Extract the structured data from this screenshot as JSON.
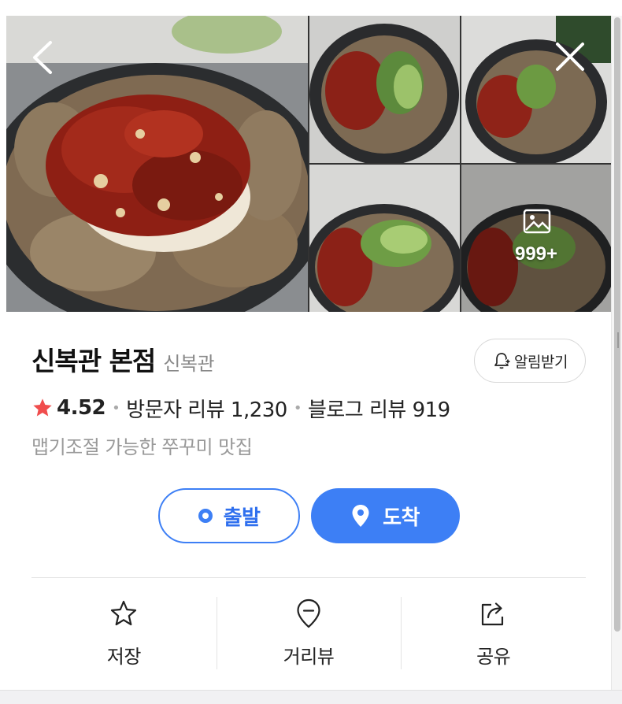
{
  "place": {
    "name": "신복관 본점",
    "category": "신복관",
    "rating": "4.52",
    "visitor_reviews": "방문자 리뷰 1,230",
    "blog_reviews": "블로그 리뷰 919",
    "description": "맵기조절 가능한 쭈꾸미 맛집"
  },
  "gallery": {
    "more_count": "999+",
    "icons": {
      "back": "chevron-left-icon",
      "close": "close-icon",
      "more": "image-icon"
    }
  },
  "buttons": {
    "alarm": "알림받기",
    "depart": "출발",
    "arrive": "도착"
  },
  "actions": [
    {
      "label": "저장",
      "icon": "star-outline-icon"
    },
    {
      "label": "거리뷰",
      "icon": "street-view-pin-icon"
    },
    {
      "label": "공유",
      "icon": "share-icon"
    }
  ],
  "colors": {
    "accent": "#3d7ff5",
    "rating_star": "#f04d4d",
    "muted_text": "#999999"
  }
}
